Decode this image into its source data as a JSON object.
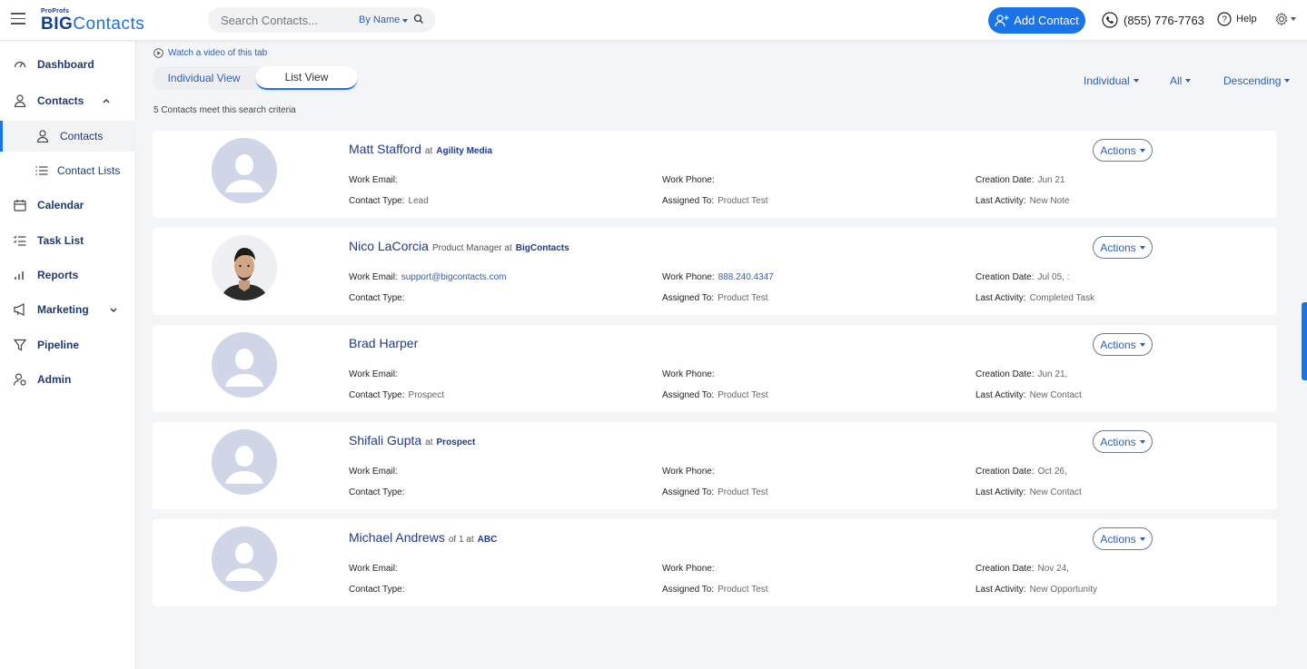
{
  "header": {
    "logo_small": "ProProfs",
    "logo_big_bold": "BIG",
    "logo_big_rest": "Contacts",
    "search_placeholder": "Search Contacts...",
    "search_mode": "By Name",
    "add_contact_label": "Add Contact",
    "phone": "(855) 776-7763",
    "help_label": "Help"
  },
  "sidebar": {
    "items": [
      {
        "label": "Dashboard",
        "icon": "dashboard-icon"
      },
      {
        "label": "Contacts",
        "icon": "person-icon"
      },
      {
        "label": "Contacts",
        "icon": "person-icon"
      },
      {
        "label": "Contact Lists",
        "icon": "list-icon"
      },
      {
        "label": "Calendar",
        "icon": "calendar-icon"
      },
      {
        "label": "Task List",
        "icon": "checklist-icon"
      },
      {
        "label": "Reports",
        "icon": "bar-chart-icon"
      },
      {
        "label": "Marketing",
        "icon": "megaphone-icon"
      },
      {
        "label": "Pipeline",
        "icon": "funnel-icon"
      },
      {
        "label": "Admin",
        "icon": "admin-icon"
      }
    ]
  },
  "main": {
    "watch_video": "Watch a video of this tab",
    "view_tabs": [
      "Individual View",
      "List View"
    ],
    "filters": [
      "Individual",
      "All",
      "Descending"
    ],
    "result_count": "5 Contacts meet this search criteria",
    "labels": {
      "work_email": "Work Email:",
      "work_phone": "Work Phone:",
      "creation_date": "Creation Date:",
      "contact_type": "Contact Type:",
      "assigned_to": "Assigned To:",
      "last_activity": "Last Activity:",
      "actions": "Actions"
    },
    "contacts": [
      {
        "name": "Matt Stafford",
        "subtitle": "at",
        "company": "Agility Media",
        "work_email": "",
        "work_phone": "",
        "creation_date": "Jun 21",
        "contact_type": "Lead",
        "assigned_to": "Product Test",
        "last_activity": "New Note"
      },
      {
        "name": "Nico LaCorcia",
        "subtitle": "Product Manager at",
        "company": "BigContacts",
        "work_email": "support@bigcontacts.com",
        "work_phone": "888.240.4347",
        "creation_date": "Jul 05, :",
        "contact_type": "",
        "assigned_to": "Product Test",
        "last_activity": "Completed Task"
      },
      {
        "name": "Brad Harper",
        "subtitle": "",
        "company": "",
        "work_email": "",
        "work_phone": "",
        "creation_date": "Jun 21,",
        "contact_type": "Prospect",
        "assigned_to": "Product Test",
        "last_activity": "New Contact"
      },
      {
        "name": "Shifali Gupta",
        "subtitle": "at",
        "company": "Prospect",
        "work_email": "",
        "work_phone": "",
        "creation_date": "Oct 26,",
        "contact_type": "",
        "assigned_to": "Product Test",
        "last_activity": "New Contact"
      },
      {
        "name": "Michael Andrews",
        "subtitle": "of 1 at",
        "company": "ABC",
        "work_email": "",
        "work_phone": "",
        "creation_date": "Nov 24,",
        "contact_type": "",
        "assigned_to": "Product Test",
        "last_activity": "New Opportunity"
      }
    ]
  },
  "colors": {
    "accent": "#1a73e8",
    "link": "#2d5fb0",
    "nav_text": "#1f3a6e",
    "avatar_placeholder": "#d0d5e8"
  }
}
